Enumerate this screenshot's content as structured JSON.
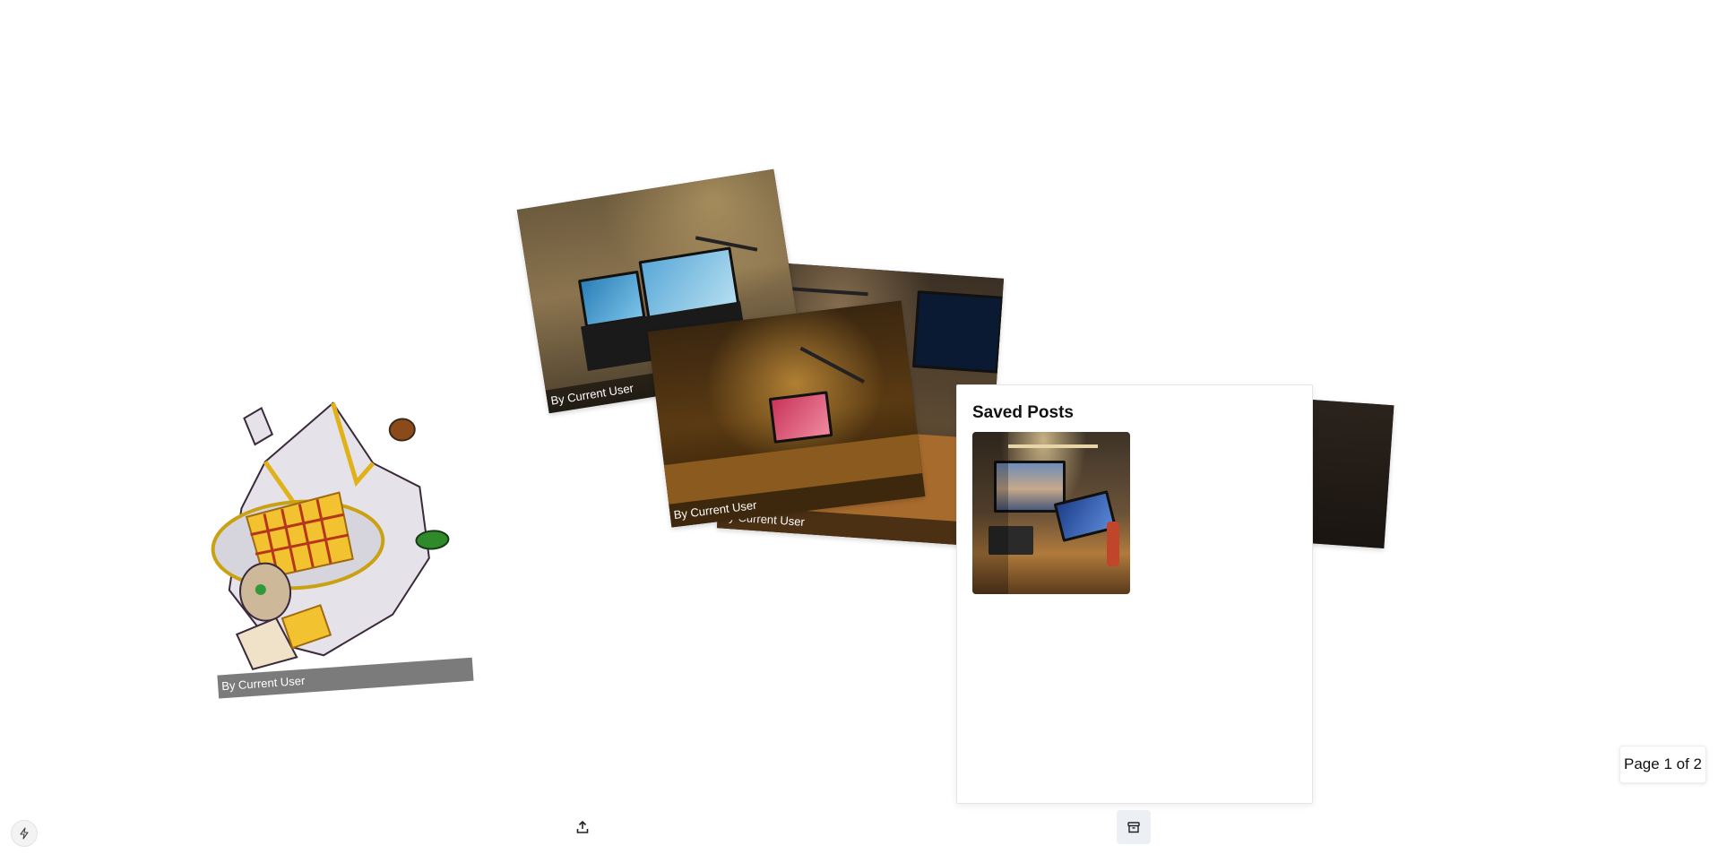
{
  "feed": {
    "cards": [
      {
        "caption": "By Current User"
      },
      {
        "caption": "By Current User"
      },
      {
        "caption": "By Current User"
      },
      {
        "caption": "By Current User"
      },
      {
        "caption": "By Current User"
      }
    ]
  },
  "saved_posts": {
    "title": "Saved Posts"
  },
  "pagination": {
    "label": "Page 1 of 2"
  },
  "toolbar": {
    "upload_icon": "upload-icon",
    "archive_icon": "archive-icon",
    "bolt_icon": "bolt-icon"
  },
  "colors": {
    "panel_border": "#e5e5e5",
    "archive_button_bg": "#eceff3",
    "caption_bg": "rgba(0,0,0,0.55)"
  }
}
